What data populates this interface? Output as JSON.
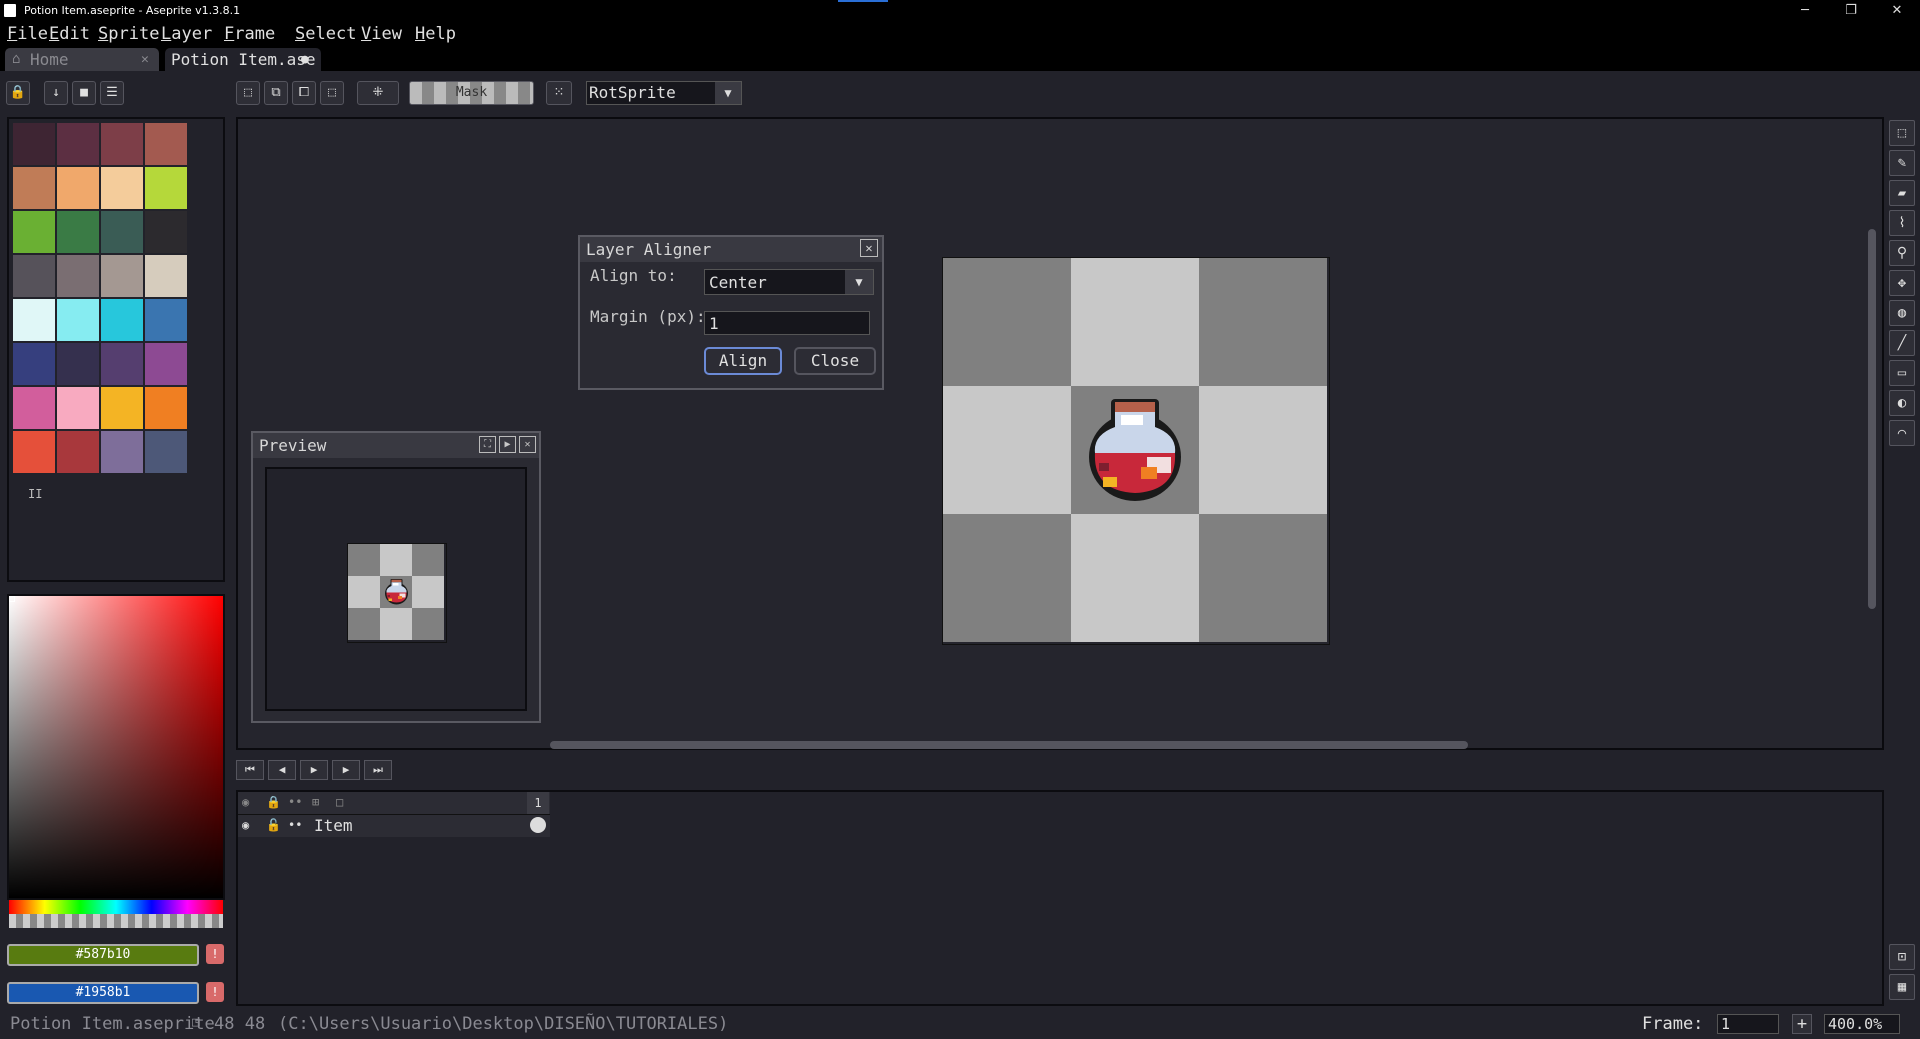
{
  "window": {
    "title": "Potion Item.aseprite - Aseprite v1.3.8.1"
  },
  "menu": [
    "File",
    "Edit",
    "Sprite",
    "Layer",
    "Frame",
    "Select",
    "View",
    "Help"
  ],
  "tabs": [
    {
      "label": "Home",
      "close": "✕"
    },
    {
      "label": "Potion Item.ase",
      "dot": "●"
    }
  ],
  "toolbar": {
    "mask_label": "Mask",
    "rotation_algorithm": "RotSprite"
  },
  "palette": {
    "colors": [
      "#3e2533",
      "#5c2f42",
      "#7d3e48",
      "#a35a50",
      "#c07c57",
      "#f0a86b",
      "#f4cc9b",
      "#b5d83a",
      "#6ab033",
      "#3a7b45",
      "#3a5c55",
      "#2c2a2e",
      "#56525a",
      "#7a6e72",
      "#a49892",
      "#d6ccbd",
      "#e0f7f7",
      "#86ecf1",
      "#27c7dc",
      "#3a75b0",
      "#363f7e",
      "#35304e",
      "#553e6f",
      "#8d4a93",
      "#d25e9c",
      "#f8aac0",
      "#f4b424",
      "#f07f22",
      "#e5503a",
      "#a8383c",
      "#7e6e9a",
      "#4d5878"
    ],
    "indicator": "II"
  },
  "color_bar": {
    "foreground_hex": "#587b10",
    "foreground_color": "#587b10",
    "background_hex": "#1958b1",
    "background_color": "#1958b1"
  },
  "dialog": {
    "title": "Layer Aligner",
    "align_to_label": "Align to:",
    "align_to_value": "Center",
    "margin_label": "Margin (px):",
    "margin_value": "1",
    "align_button": "Align",
    "close_button": "Close"
  },
  "preview": {
    "title": "Preview"
  },
  "timeline": {
    "frame_header": "1",
    "layers": [
      {
        "name": "Item"
      }
    ]
  },
  "statusbar": {
    "filename": "Potion Item.aseprite",
    "size": "48 48",
    "path": "(C:\\Users\\Usuario\\Desktop\\DISEÑO\\TUTORIALES)",
    "frame_label": "Frame:",
    "frame_value": "1",
    "zoom": "400.0%"
  },
  "colors": {
    "checker_light": "#c8c8c8",
    "checker_dark": "#808080",
    "accent_blue": "#2a6fd6"
  }
}
